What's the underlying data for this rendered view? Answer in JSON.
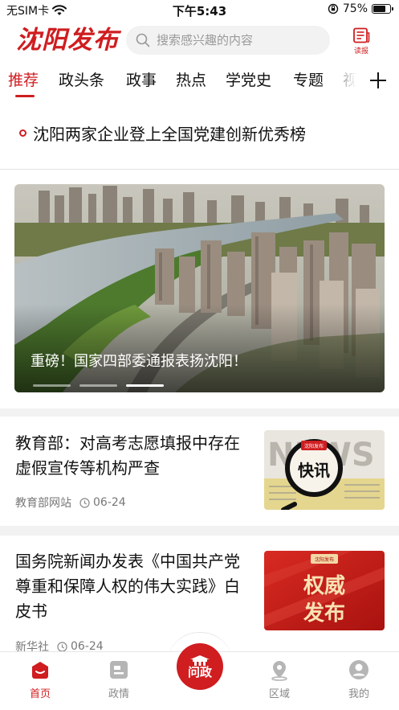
{
  "status_bar": {
    "carrier": "无SIM卡",
    "time": "下午5:43",
    "battery_percent": "75%",
    "battery_level": 0.75
  },
  "header": {
    "logo_text": "沈阳发布",
    "search_placeholder": "搜索感兴趣的内容",
    "read_label": "读报"
  },
  "tabs": [
    {
      "label": "推荐",
      "active": true
    },
    {
      "label": "政头条"
    },
    {
      "label": "政事"
    },
    {
      "label": "热点"
    },
    {
      "label": "学党史"
    },
    {
      "label": "专题"
    },
    {
      "label": "视"
    }
  ],
  "ticker": {
    "text": "沈阳两家企业登上全国党建创新优秀榜"
  },
  "carousel": {
    "title": "重磅！国家四部委通报表扬沈阳！",
    "slide_count": 3,
    "active_index": 2
  },
  "news": [
    {
      "title": "教育部：对高考志愿填报中存在虚假宣传等机构严查",
      "source": "教育部网站",
      "date": "06-24",
      "thumb": {
        "word": "NEWS",
        "label": "快讯",
        "banner": "沈阳发布"
      }
    },
    {
      "title": "国务院新闻办发表《中国共产党尊重和保障人权的伟大实践》白皮书",
      "source": "新华社",
      "date": "06-24",
      "thumb": {
        "label_line1": "权威",
        "label_line2": "发布",
        "banner": "沈阳发布"
      }
    }
  ],
  "bottom_nav": {
    "items": [
      {
        "label": "首页",
        "icon": "home-icon",
        "active": true
      },
      {
        "label": "政情",
        "icon": "news-icon"
      },
      {
        "label": "区域",
        "icon": "location-icon"
      },
      {
        "label": "我的",
        "icon": "profile-icon"
      }
    ],
    "center_label": "问政"
  },
  "colors": {
    "brand_red": "#cf1d20",
    "text": "#111111",
    "muted": "#777777"
  }
}
